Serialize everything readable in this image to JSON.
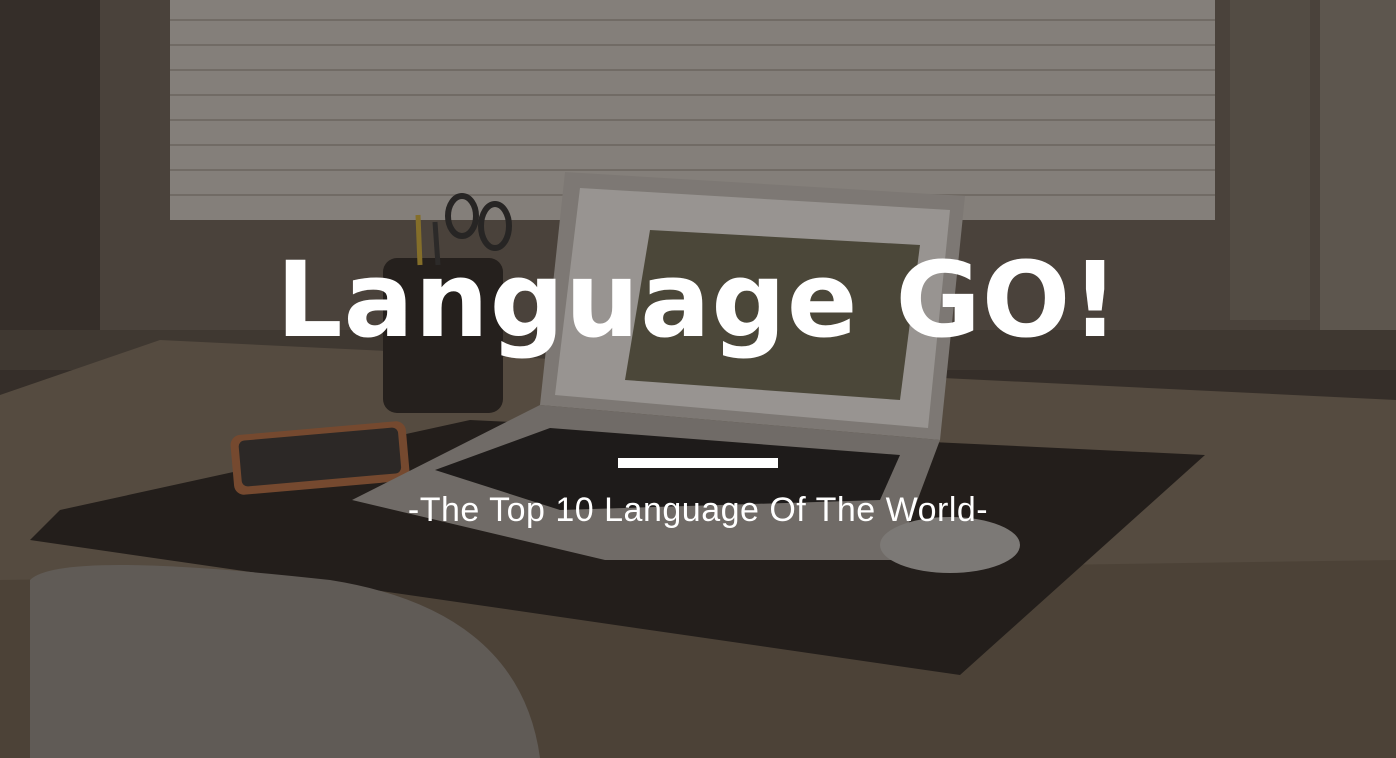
{
  "hero": {
    "title": "Language GO!",
    "subtitle": "-The Top 10 Language Of The World-"
  },
  "background": {
    "description_icon": "desk-workspace-photo",
    "overlay_color": "#14100c"
  },
  "colors": {
    "text": "#ffffff",
    "divider": "#ffffff"
  }
}
